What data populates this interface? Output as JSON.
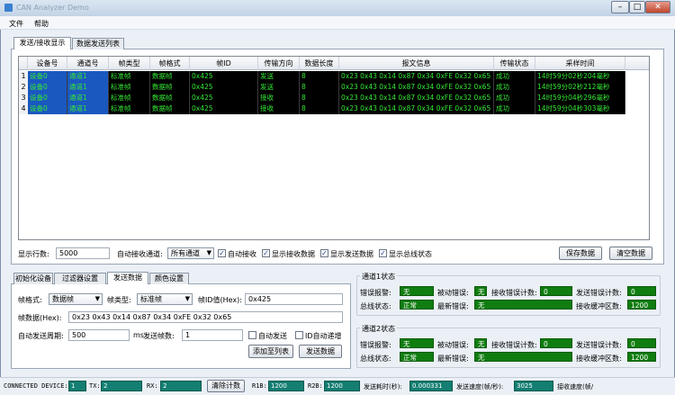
{
  "window": {
    "title": "CAN Analyzer Demo",
    "minimize": "–",
    "maximize": "□",
    "close": "✕"
  },
  "menu": [
    "文件",
    "帮助"
  ],
  "main_tabs": [
    "发送/接收显示",
    "数据发送列表"
  ],
  "table": {
    "columns": [
      "设备号",
      "通道号",
      "帧类型",
      "帧格式",
      "帧ID",
      "传输方向",
      "数据长度",
      "报文信息",
      "传输状态",
      "采样时间"
    ],
    "rows": [
      [
        "1",
        "设备0",
        "通道1",
        "标准帧",
        "数据帧",
        "0x425",
        "发送",
        "8",
        "0x23 0x43 0x14 0x87 0x34 0xFE 0x32 0x65",
        "成功",
        "14时59分02秒204毫秒"
      ],
      [
        "2",
        "设备0",
        "通道1",
        "标准帧",
        "数据帧",
        "0x425",
        "发送",
        "8",
        "0x23 0x43 0x14 0x87 0x34 0xFE 0x32 0x65",
        "成功",
        "14时59分02秒212毫秒"
      ],
      [
        "3",
        "设备0",
        "通道1",
        "标准帧",
        "数据帧",
        "0x425",
        "接收",
        "8",
        "0x23 0x43 0x14 0x87 0x34 0xFE 0x32 0x65",
        "成功",
        "14时59分04秒296毫秒"
      ],
      [
        "4",
        "设备0",
        "通道1",
        "标准帧",
        "数据帧",
        "0x425",
        "接收",
        "8",
        "0x23 0x43 0x14 0x87 0x34 0xFE 0x32 0x65",
        "成功",
        "14时59分04秒303毫秒"
      ]
    ]
  },
  "controls": {
    "rows_label": "显示行数:",
    "rows_value": "5000",
    "auto_channel_label": "自动接收通道:",
    "channel_value": "所有通道",
    "auto_receive": "自动接收",
    "show_receive": "显示接收数据",
    "show_send": "显示发送数据",
    "show_bus": "显示总线状态",
    "save": "保存数据",
    "clear": "清空数据"
  },
  "bottom_tabs": [
    "初始化设备",
    "过滤器设置",
    "发送数据",
    "颜色设置"
  ],
  "send": {
    "frame_format_label": "帧格式:",
    "frame_format_value": "数据帧",
    "frame_type_label": "帧类型:",
    "frame_type_value": "标准帧",
    "frame_id_label": "帧ID值(Hex):",
    "frame_id_value": "0x425",
    "frame_data_label": "帧数据(Hex):",
    "frame_data_value": "0x23 0x43 0x14 0x87 0x34 0xFE 0x32 0x65",
    "period_label": "自动发送周期:",
    "period_value": "500",
    "period_unit": "ms",
    "count_label": "发送帧数:",
    "count_value": "1",
    "auto_send": "自动发送",
    "id_auto_inc": "ID自动递增",
    "add_list": "添加至列表",
    "send_btn": "发送数据"
  },
  "channels": [
    {
      "title": "通道1状态",
      "err_alarm": "错误报警:",
      "err_alarm_v": "无",
      "passive_err": "被动错误:",
      "passive_err_v": "无",
      "rx_err_count": "接收错误计数:",
      "rx_err_count_v": "0",
      "tx_err_count": "发送错误计数:",
      "tx_err_count_v": "0",
      "bus_state": "总线状态:",
      "bus_state_v": "正常",
      "last_err": "最新错误:",
      "last_err_v": "无",
      "rx_buf": "接收缓冲区数:",
      "rx_buf_v": "1200"
    },
    {
      "title": "通道2状态",
      "err_alarm": "错误报警:",
      "err_alarm_v": "无",
      "passive_err": "被动错误:",
      "passive_err_v": "无",
      "rx_err_count": "接收错误计数:",
      "rx_err_count_v": "0",
      "tx_err_count": "发送错误计数:",
      "tx_err_count_v": "0",
      "bus_state": "总线状态:",
      "bus_state_v": "正常",
      "last_err": "最新错误:",
      "last_err_v": "无",
      "rx_buf": "接收缓冲区数:",
      "rx_buf_v": "1200"
    }
  ],
  "status": {
    "device_label": "CONNECTED DEVICE:",
    "device_v": "1",
    "tx_label": "TX:",
    "tx_v": "2",
    "rx_label": "RX:",
    "rx_v": "2",
    "clear_count": "清除计数",
    "r1b_label": "R1B:",
    "r1b_v": "1200",
    "r2b_label": "R2B:",
    "r2b_v": "1200",
    "send_time_label": "发送耗时(秒):",
    "send_time_v": "0.000331",
    "send_speed_label": "发送速度(帧/秒):",
    "send_speed_v": "3025",
    "recv_speed_label": "接收速度(帧/"
  },
  "colors": {
    "cell_bg": "#000000",
    "cell_text": "#35e835",
    "selected_bg": "#1a58c0",
    "status_green": "#0f7d0f",
    "status_teal": "#137e71"
  }
}
